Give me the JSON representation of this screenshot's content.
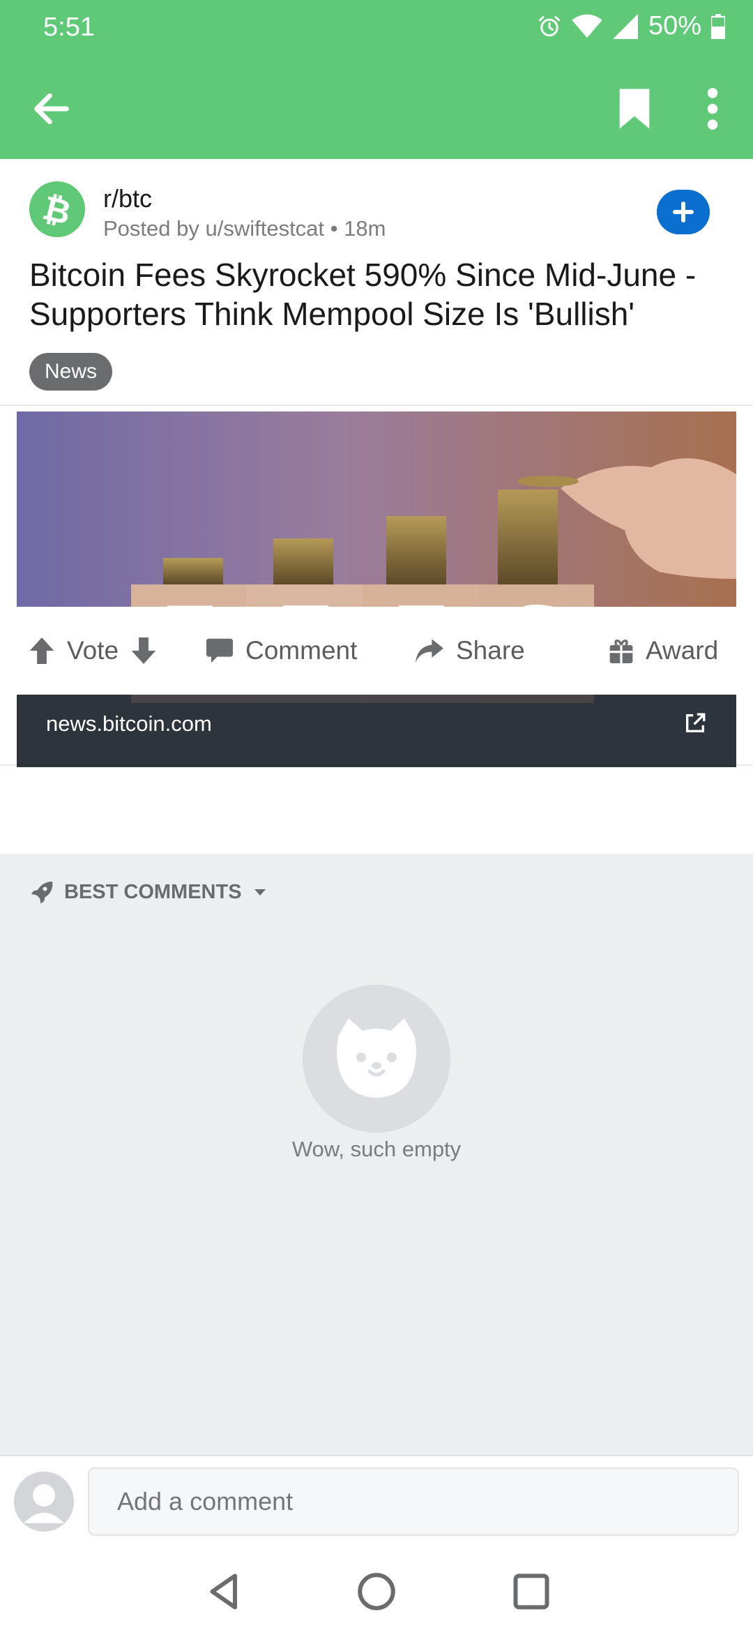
{
  "status_bar": {
    "time": "5:51",
    "battery": "50%"
  },
  "app_bar": {
    "back_icon": "arrow-left-icon",
    "bookmark_icon": "bookmark-icon",
    "more_icon": "more-vertical-icon"
  },
  "post": {
    "subreddit": "r/btc",
    "posted_by": "Posted by u/swiftestcat • 18m",
    "title": "Bitcoin Fees Skyrocket 590% Since Mid-June - Supporters Think Mempool Size Is 'Bullish'",
    "flair": "News",
    "link_domain": "news.bitcoin.com",
    "image_letters": [
      "F",
      "E",
      "E",
      "S"
    ]
  },
  "actions": {
    "vote": "Vote",
    "comment": "Comment",
    "share": "Share",
    "award": "Award"
  },
  "comments": {
    "sort_label": "BEST COMMENTS",
    "empty_text": "Wow, such empty"
  },
  "comment_bar": {
    "placeholder": "Add a comment"
  },
  "colors": {
    "accent_green": "#5fc977",
    "join_blue": "#0b6fcf",
    "flair_gray": "#6b6c6e"
  }
}
